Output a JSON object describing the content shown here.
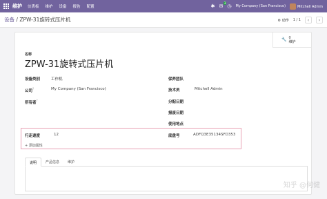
{
  "navbar": {
    "brand": "维护",
    "menu": [
      "仪表板",
      "维护",
      "设备",
      "报告",
      "配置"
    ],
    "chat_badge": "3",
    "company": "My Company (San Francisco)",
    "user": "Mitchell Admin"
  },
  "breadcrumb": {
    "root": "设备",
    "separator": "/",
    "current": "ZPW-31旋转式压片机"
  },
  "control": {
    "action_label": "动作",
    "pager": "1 / 1"
  },
  "smart_button": {
    "count": "0",
    "label": "维护"
  },
  "form": {
    "name_label": "名称",
    "name_value": "ZPW-31旋转式压片机",
    "left_fields": [
      {
        "label": "设备类别",
        "value": "工作机"
      },
      {
        "label": "公司",
        "value": "My Company (San Francisco)"
      },
      {
        "label": "所有者",
        "value": ""
      }
    ],
    "right_fields": [
      {
        "label": "保养团队",
        "value": ""
      },
      {
        "label": "技术员",
        "value": "Mitchell Admin"
      },
      {
        "label": "分配日期",
        "value": ""
      },
      {
        "label": "报废日期",
        "value": ""
      },
      {
        "label": "使用地点",
        "value": ""
      }
    ],
    "custom_fields": [
      {
        "label": "行走速度",
        "value": "12"
      },
      {
        "label": "底盘号",
        "value": "ADFQ3E35134SFD353"
      }
    ],
    "add_attribute": "添加属性",
    "tabs": [
      "说明",
      "产品信息",
      "维护"
    ]
  },
  "watermark": "知乎 @何健",
  "colors": {
    "navbar": "#71639e",
    "highlight_border": "#e8a0b4"
  }
}
